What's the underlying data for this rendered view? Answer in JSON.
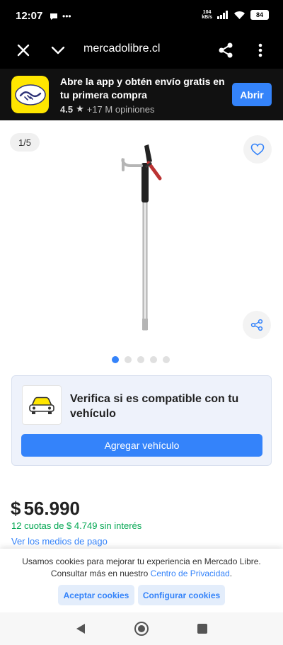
{
  "status_bar": {
    "time": "12:07",
    "net_speed_value": "104",
    "net_speed_unit": "kB/s",
    "battery": "84"
  },
  "browser": {
    "url": "mercadolibre.cl"
  },
  "app_banner": {
    "title": "Abre la app y obtén envío gratis en tu primera compra",
    "rating_score": "4.5",
    "rating_count": "+17 M opiniones",
    "open_button": "Abrir"
  },
  "gallery": {
    "counter": "1/5",
    "total_images": 5,
    "active_index": 0
  },
  "compat": {
    "text": "Verifica si es compatible con tu vehículo",
    "button": "Agregar vehículo"
  },
  "price": {
    "currency": "$",
    "amount": "56.990",
    "installments": "12 cuotas de $ 4.749 sin interés",
    "payment_link": "Ver los medios de pago"
  },
  "cookies": {
    "text_line1": "Usamos cookies para mejorar tu experiencia en Mercado Libre.",
    "text_line2_prefix": "Consultar más en nuestro ",
    "privacy_link": "Centro de Privacidad",
    "text_line2_suffix": ".",
    "accept": "Aceptar cookies",
    "configure": "Configurar cookies"
  },
  "colors": {
    "accent": "#3483fa",
    "brand_yellow": "#ffe600",
    "installments_green": "#00a650"
  }
}
